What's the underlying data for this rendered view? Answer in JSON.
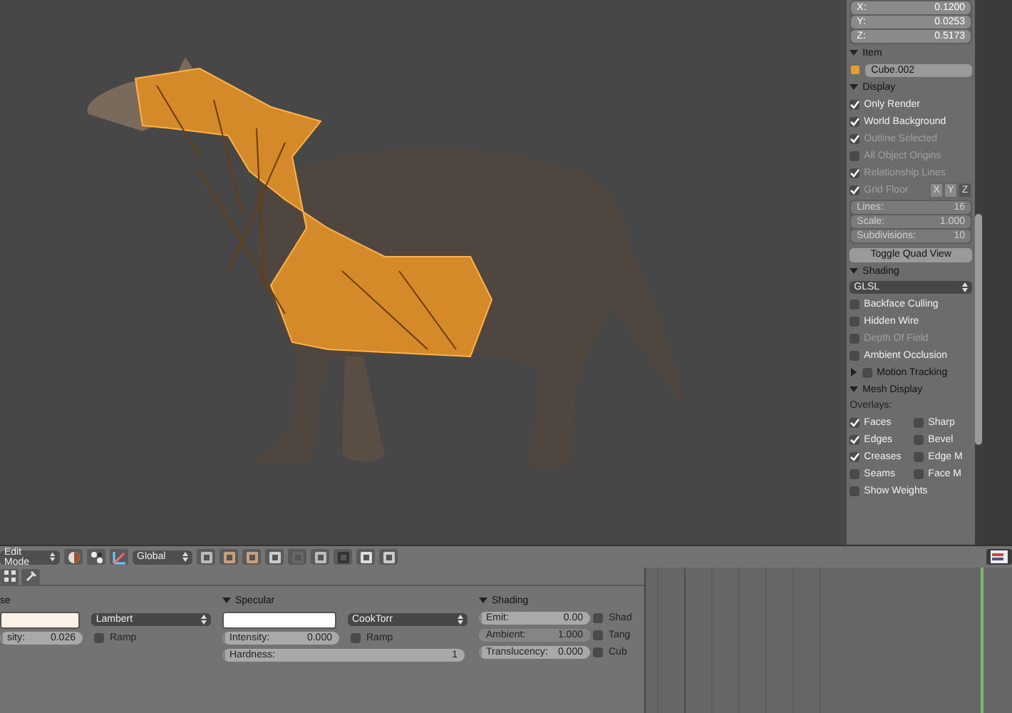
{
  "n_panel": {
    "transform": [
      {
        "label": "X:",
        "value": "0.1200"
      },
      {
        "label": "Y:",
        "value": "0.0253"
      },
      {
        "label": "Z:",
        "value": "0.5173"
      }
    ],
    "item": {
      "title": "Item",
      "expanded": true,
      "name": "Cube.002"
    },
    "display": {
      "title": "Display",
      "expanded": true,
      "options": [
        {
          "kind": "check",
          "label": "Only Render",
          "checked": true,
          "disabled": false
        },
        {
          "kind": "check",
          "label": "World Background",
          "checked": true,
          "disabled": false
        },
        {
          "kind": "check",
          "label": "Outline Selected",
          "checked": true,
          "disabled": true
        },
        {
          "kind": "check",
          "label": "All Object Origins",
          "checked": false,
          "disabled": true
        },
        {
          "kind": "check",
          "label": "Relationship Lines",
          "checked": true,
          "disabled": true
        },
        {
          "kind": "grid_floor",
          "label": "Grid Floor",
          "checked": true,
          "disabled": true
        }
      ],
      "grid_axes": [
        {
          "label": "X",
          "selected": false
        },
        {
          "label": "Y",
          "selected": false
        },
        {
          "label": "Z",
          "selected": true
        }
      ],
      "grid_fields": [
        {
          "label": "Lines:",
          "value": "16",
          "disabled": true
        },
        {
          "label": "Scale:",
          "value": "1.000",
          "disabled": true
        },
        {
          "label": "Subdivisions:",
          "value": "10",
          "disabled": true
        }
      ],
      "button": "Toggle Quad View"
    },
    "shading": {
      "title": "Shading",
      "expanded": true,
      "mode": "GLSL",
      "options": [
        {
          "label": "Backface Culling",
          "checked": false,
          "disabled": false
        },
        {
          "label": "Hidden Wire",
          "checked": false,
          "disabled": false
        },
        {
          "label": "Depth Of Field",
          "checked": false,
          "disabled": true
        },
        {
          "label": "Ambient Occlusion",
          "checked": false,
          "disabled": false
        }
      ]
    },
    "motion_tracking": {
      "title": "Motion Tracking",
      "expanded": false,
      "checked": false
    },
    "mesh_display": {
      "title": "Mesh Display",
      "expanded": true,
      "overlays_label": "Overlays:",
      "overlays": [
        {
          "label": "Faces",
          "checked": true
        },
        {
          "label": "Sharp",
          "checked": false
        },
        {
          "label": "Edges",
          "checked": true
        },
        {
          "label": "Bevel",
          "checked": false
        },
        {
          "label": "Creases",
          "checked": true
        },
        {
          "label": "Edge M",
          "checked": false
        },
        {
          "label": "Seams",
          "checked": false
        },
        {
          "label": "Face M",
          "checked": false
        }
      ],
      "show_weights": {
        "label": "Show Weights",
        "checked": false
      }
    }
  },
  "header": {
    "mode": "Edit Mode",
    "orientation": "Global"
  },
  "properties": {
    "panels": [
      {
        "kind": "diffuse",
        "title": "se",
        "color": "#fcf1e6",
        "shader": "Lambert",
        "intensity": {
          "label": "sity:",
          "value": "0.026",
          "level": 0.026
        },
        "ramp": {
          "label": "Ramp",
          "checked": false
        }
      },
      {
        "kind": "specular",
        "title": "Specular",
        "expanded": true,
        "color": "#ffffff",
        "shader": "CookTorr",
        "intensity": {
          "label": "Intensity:",
          "value": "0.000",
          "level": 0
        },
        "ramp": {
          "label": "Ramp",
          "checked": false
        },
        "hardness": {
          "label": "Hardness:",
          "value": "1",
          "level": 0.002
        }
      },
      {
        "kind": "shading",
        "title": "Shading",
        "expanded": true,
        "fields": [
          {
            "label": "Emit:",
            "value": "0.00",
            "level": 0
          },
          {
            "label": "Ambient:",
            "value": "1.000",
            "level": 1
          },
          {
            "label": "Translucency:",
            "value": "0.000",
            "level": 0
          }
        ],
        "checks": [
          {
            "label": "Shad",
            "checked": false
          },
          {
            "label": "Tang",
            "checked": false
          },
          {
            "label": "Cub",
            "checked": false
          }
        ]
      }
    ]
  }
}
